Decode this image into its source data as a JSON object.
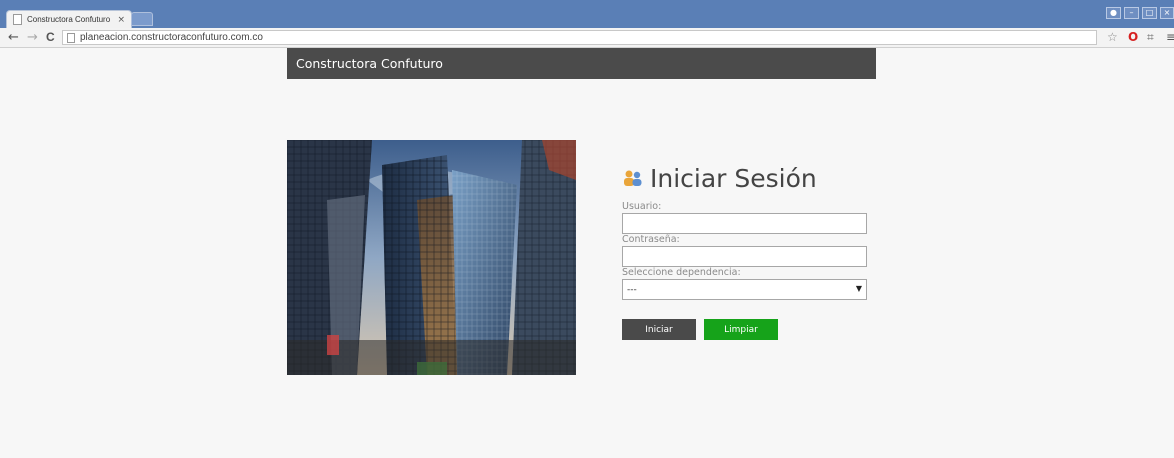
{
  "browser": {
    "tab_title": "Constructora Confuturo",
    "tab_close": "×",
    "url": "planeacion.constructoraconfuturo.com.co",
    "nav_back": "←",
    "nav_forward": "→",
    "nav_reload": "C",
    "bookmark_icon": "star-icon",
    "ext_icon": "opera-icon",
    "menu_icon": "menu-icon"
  },
  "header": {
    "site_title": "Constructora Confuturo"
  },
  "login": {
    "title": "Iniciar Sesión",
    "icon": "users-icon",
    "username_label": "Usuario:",
    "username_value": "",
    "password_label": "Contraseña:",
    "password_value": "",
    "dependency_label": "Seleccione dependencia:",
    "dependency_selected": "---",
    "submit_label": "Iniciar",
    "clear_label": "Limpiar"
  },
  "colors": {
    "header_bg": "#4b4b4b",
    "submit_bg": "#4a4a4a",
    "clear_bg": "#16a31a",
    "page_bg": "#f7f7f7"
  }
}
